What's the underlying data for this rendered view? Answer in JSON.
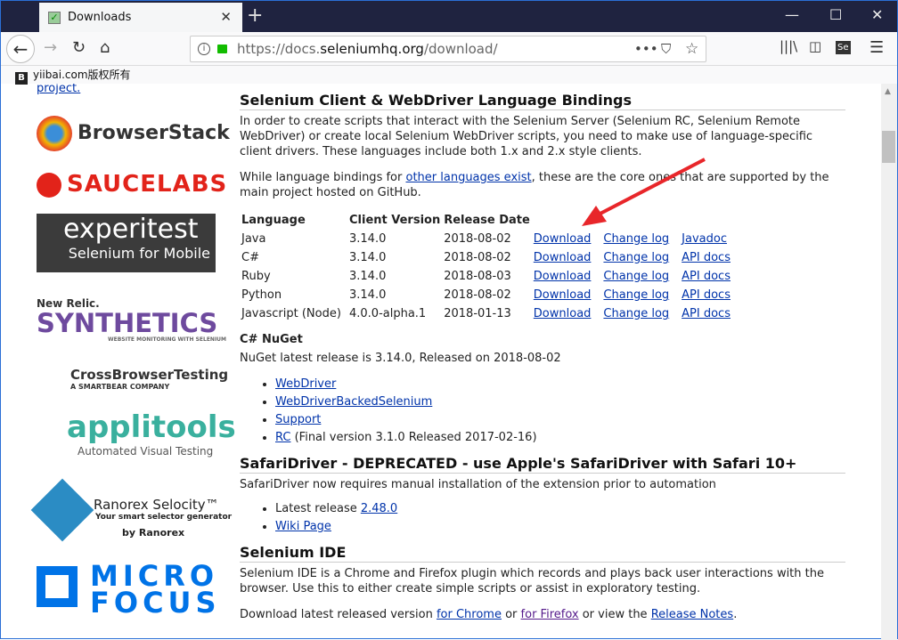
{
  "browser": {
    "tab_title": "Downloads",
    "url_prefix": "https://docs.",
    "url_domain": "seleniumhq.org",
    "url_path": "/download/",
    "bookmark": "yiibai.com版权所有",
    "bookmark_icon": "B"
  },
  "sidebar": {
    "top_link": "project.",
    "logos": [
      "BrowserStack",
      "SAUCELABS",
      "experitest",
      "Selenium for Mobile",
      "New Relic.",
      "SYNTHETICS",
      "WEBSITE MONITORING WITH SELENIUM",
      "CrossBrowserTesting",
      "A SMARTBEAR COMPANY",
      "applitools",
      "Automated Visual Testing",
      "Ranorex Selocity™",
      "Your smart selector generator",
      "by Ranorex",
      "MICRO",
      "FOCUS"
    ]
  },
  "bindings": {
    "title": "Selenium Client & WebDriver Language Bindings",
    "intro": "In order to create scripts that interact with the Selenium Server (Selenium RC, Selenium Remote WebDriver) or create local Selenium WebDriver scripts, you need to make use of language-specific client drivers. These languages include both 1.x and 2.x style clients.",
    "p2_a": "While language bindings for ",
    "p2_link": "other languages exist",
    "p2_b": ", these are the core ones that are supported by the main project hosted on GitHub.",
    "headers": [
      "Language",
      "Client Version",
      "Release Date"
    ],
    "rows": [
      {
        "lang": "Java",
        "ver": "3.14.0",
        "date": "2018-08-02",
        "dl": "Download",
        "log": "Change log",
        "docs": "Javadoc"
      },
      {
        "lang": "C#",
        "ver": "3.14.0",
        "date": "2018-08-02",
        "dl": "Download",
        "log": "Change log",
        "docs": "API docs"
      },
      {
        "lang": "Ruby",
        "ver": "3.14.0",
        "date": "2018-08-03",
        "dl": "Download",
        "log": "Change log",
        "docs": "API docs"
      },
      {
        "lang": "Python",
        "ver": "3.14.0",
        "date": "2018-08-02",
        "dl": "Download",
        "log": "Change log",
        "docs": "API docs"
      },
      {
        "lang": "Javascript (Node)",
        "ver": "4.0.0-alpha.1",
        "date": "2018-01-13",
        "dl": "Download",
        "log": "Change log",
        "docs": "API docs"
      }
    ]
  },
  "nuget": {
    "title": "C# NuGet",
    "text": "NuGet latest release is 3.14.0, Released on 2018-08-02",
    "items": [
      "WebDriver",
      "WebDriverBackedSelenium",
      "Support",
      "RC"
    ],
    "rc_note": " (Final version 3.1.0 Released 2017-02-16)"
  },
  "safari": {
    "title": "SafariDriver - DEPRECATED - use Apple's SafariDriver with Safari 10+",
    "text": "SafariDriver now requires manual installation of the extension prior to automation",
    "latest_label": "Latest release ",
    "latest_link": "2.48.0",
    "wiki": "Wiki Page"
  },
  "ide": {
    "title": "Selenium IDE",
    "text": "Selenium IDE is a Chrome and Firefox plugin which records and plays back user interactions with the browser. Use this to either create simple scripts or assist in exploratory testing.",
    "dl_a": "Download latest released version ",
    "chrome": "for Chrome",
    "or": " or ",
    "firefox": "for Firefox",
    "view": " or view the ",
    "notes": "Release Notes",
    "end": "."
  }
}
